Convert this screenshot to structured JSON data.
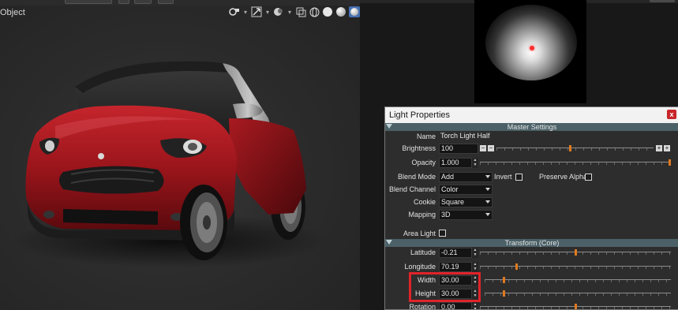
{
  "viewport": {
    "object_label": "Object",
    "toolbar_icons": [
      "camera-icon",
      "chevron-down-icon",
      "gizmo-icon",
      "chevron-down-icon",
      "overlay-icon",
      "chevron-down-icon",
      "xray-icon",
      "wireframe-shading-icon",
      "solid-shading-icon",
      "material-shading-icon",
      "rendered-shading-icon"
    ],
    "shading_active": "rendered"
  },
  "preview": {
    "light_color": "#ffffff",
    "marker_color": "#ff3030"
  },
  "light_properties": {
    "title": "Light Properties",
    "close_label": "x",
    "master_settings": {
      "header": "Master Settings",
      "name_label": "Name",
      "name_value": "Torch Light Half",
      "brightness_label": "Brightness",
      "brightness_value": "100",
      "brightness_level": 0.47,
      "opacity_label": "Opacity",
      "opacity_value": "1.000",
      "opacity_level": 1.0,
      "blend_mode_label": "Blend Mode",
      "blend_mode_value": "Add",
      "invert_label": "Invert",
      "invert_checked": false,
      "preserve_alpha_label": "Preserve Alpha",
      "preserve_alpha_checked": false,
      "blend_channel_label": "Blend Channel",
      "blend_channel_value": "Color",
      "cookie_label": "Cookie",
      "cookie_value": "Square",
      "mapping_label": "Mapping",
      "mapping_value": "3D",
      "area_light_label": "Area Light",
      "area_light_checked": false
    },
    "transform_core": {
      "header": "Transform (Core)",
      "latitude_label": "Latitude",
      "latitude_value": "-0.21",
      "latitude_level": 0.5,
      "longitude_label": "Longitude",
      "longitude_value": "70.19",
      "longitude_level": 0.19,
      "width_label": "Width",
      "width_value": "30.00",
      "width_level": 0.1,
      "height_label": "Height",
      "height_value": "30.00",
      "height_level": 0.1,
      "rotation_label": "Rotation",
      "rotation_value": "0.00",
      "rotation_level": 0.5
    },
    "highlight_color": "#e0232a",
    "accent_color": "#e07a1f"
  }
}
